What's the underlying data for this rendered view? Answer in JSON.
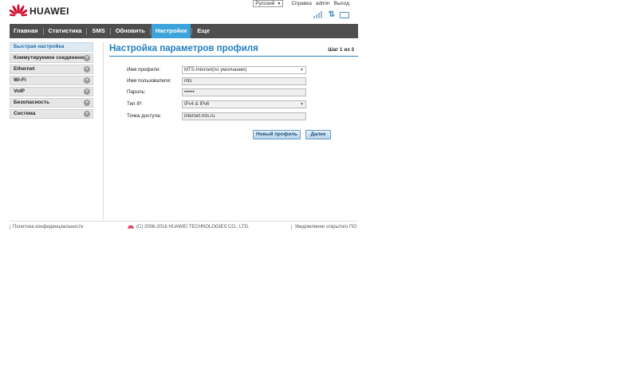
{
  "brand": {
    "name": "HUAWEI",
    "color": "#cf0a2c"
  },
  "topbar": {
    "language": "Русский",
    "help": "Справка",
    "user": "admin",
    "logout": "Выход"
  },
  "status_icons": [
    "signal-icon",
    "data-transfer-icon",
    "pc-connection-icon"
  ],
  "nav": {
    "items": [
      {
        "label": "Главная"
      },
      {
        "label": "Статистика"
      },
      {
        "label": "SMS"
      },
      {
        "label": "Обновить"
      },
      {
        "label": "Настройки",
        "active": true
      },
      {
        "label": "Еще"
      }
    ],
    "active_color": "#3da3db"
  },
  "sidebar": {
    "items": [
      {
        "label": "Быстрая настройка"
      },
      {
        "label": "Коммутируемое соединение"
      },
      {
        "label": "Ethernet"
      },
      {
        "label": "Wi-Fi"
      },
      {
        "label": "VoIP"
      },
      {
        "label": "Безопасность"
      },
      {
        "label": "Система"
      }
    ]
  },
  "main": {
    "title": "Настройка параметров профиля",
    "step": "Шаг 1 из 3",
    "form": {
      "profile_name": {
        "label": "Имя профиля:",
        "value": "MTS-Internet(по умолчанию)"
      },
      "username": {
        "label": "Имя пользователя:",
        "value": "mts"
      },
      "password": {
        "label": "Пароль:",
        "value": "••••••"
      },
      "ip_type": {
        "label": "Тип IP:",
        "value": "IPv4 & IPv6"
      },
      "apn": {
        "label": "Точка доступа:",
        "value": "internet.mts.ru"
      }
    },
    "buttons": {
      "new_profile": "Новый профиль",
      "next": "Далее"
    }
  },
  "footer": {
    "privacy": "Политика конфиденциальности",
    "copyright": "(C) 2006-2016 HUAWEI TECHNOLOGIES CO., LTD.",
    "oss": "Уведомление открытого ПО"
  }
}
